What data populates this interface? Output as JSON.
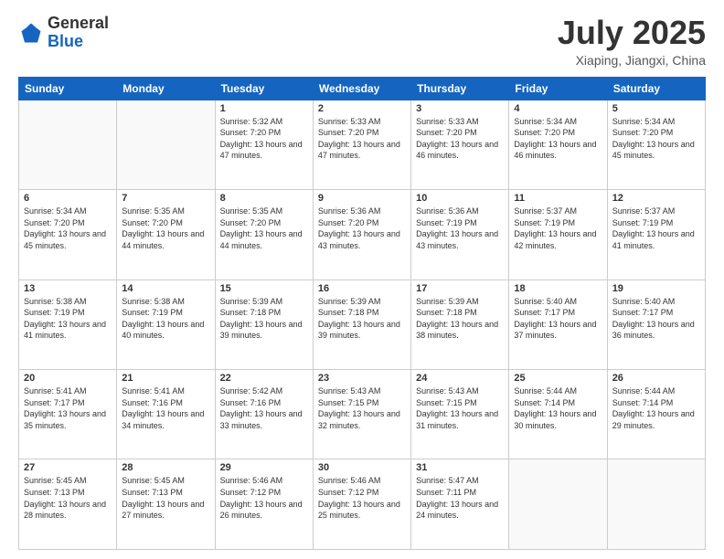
{
  "header": {
    "logo_general": "General",
    "logo_blue": "Blue",
    "month_title": "July 2025",
    "location": "Xiaping, Jiangxi, China"
  },
  "days_of_week": [
    "Sunday",
    "Monday",
    "Tuesday",
    "Wednesday",
    "Thursday",
    "Friday",
    "Saturday"
  ],
  "weeks": [
    [
      {
        "day": "",
        "sunrise": "",
        "sunset": "",
        "daylight": ""
      },
      {
        "day": "",
        "sunrise": "",
        "sunset": "",
        "daylight": ""
      },
      {
        "day": "1",
        "sunrise": "Sunrise: 5:32 AM",
        "sunset": "Sunset: 7:20 PM",
        "daylight": "Daylight: 13 hours and 47 minutes."
      },
      {
        "day": "2",
        "sunrise": "Sunrise: 5:33 AM",
        "sunset": "Sunset: 7:20 PM",
        "daylight": "Daylight: 13 hours and 47 minutes."
      },
      {
        "day": "3",
        "sunrise": "Sunrise: 5:33 AM",
        "sunset": "Sunset: 7:20 PM",
        "daylight": "Daylight: 13 hours and 46 minutes."
      },
      {
        "day": "4",
        "sunrise": "Sunrise: 5:34 AM",
        "sunset": "Sunset: 7:20 PM",
        "daylight": "Daylight: 13 hours and 46 minutes."
      },
      {
        "day": "5",
        "sunrise": "Sunrise: 5:34 AM",
        "sunset": "Sunset: 7:20 PM",
        "daylight": "Daylight: 13 hours and 45 minutes."
      }
    ],
    [
      {
        "day": "6",
        "sunrise": "Sunrise: 5:34 AM",
        "sunset": "Sunset: 7:20 PM",
        "daylight": "Daylight: 13 hours and 45 minutes."
      },
      {
        "day": "7",
        "sunrise": "Sunrise: 5:35 AM",
        "sunset": "Sunset: 7:20 PM",
        "daylight": "Daylight: 13 hours and 44 minutes."
      },
      {
        "day": "8",
        "sunrise": "Sunrise: 5:35 AM",
        "sunset": "Sunset: 7:20 PM",
        "daylight": "Daylight: 13 hours and 44 minutes."
      },
      {
        "day": "9",
        "sunrise": "Sunrise: 5:36 AM",
        "sunset": "Sunset: 7:20 PM",
        "daylight": "Daylight: 13 hours and 43 minutes."
      },
      {
        "day": "10",
        "sunrise": "Sunrise: 5:36 AM",
        "sunset": "Sunset: 7:19 PM",
        "daylight": "Daylight: 13 hours and 43 minutes."
      },
      {
        "day": "11",
        "sunrise": "Sunrise: 5:37 AM",
        "sunset": "Sunset: 7:19 PM",
        "daylight": "Daylight: 13 hours and 42 minutes."
      },
      {
        "day": "12",
        "sunrise": "Sunrise: 5:37 AM",
        "sunset": "Sunset: 7:19 PM",
        "daylight": "Daylight: 13 hours and 41 minutes."
      }
    ],
    [
      {
        "day": "13",
        "sunrise": "Sunrise: 5:38 AM",
        "sunset": "Sunset: 7:19 PM",
        "daylight": "Daylight: 13 hours and 41 minutes."
      },
      {
        "day": "14",
        "sunrise": "Sunrise: 5:38 AM",
        "sunset": "Sunset: 7:19 PM",
        "daylight": "Daylight: 13 hours and 40 minutes."
      },
      {
        "day": "15",
        "sunrise": "Sunrise: 5:39 AM",
        "sunset": "Sunset: 7:18 PM",
        "daylight": "Daylight: 13 hours and 39 minutes."
      },
      {
        "day": "16",
        "sunrise": "Sunrise: 5:39 AM",
        "sunset": "Sunset: 7:18 PM",
        "daylight": "Daylight: 13 hours and 39 minutes."
      },
      {
        "day": "17",
        "sunrise": "Sunrise: 5:39 AM",
        "sunset": "Sunset: 7:18 PM",
        "daylight": "Daylight: 13 hours and 38 minutes."
      },
      {
        "day": "18",
        "sunrise": "Sunrise: 5:40 AM",
        "sunset": "Sunset: 7:17 PM",
        "daylight": "Daylight: 13 hours and 37 minutes."
      },
      {
        "day": "19",
        "sunrise": "Sunrise: 5:40 AM",
        "sunset": "Sunset: 7:17 PM",
        "daylight": "Daylight: 13 hours and 36 minutes."
      }
    ],
    [
      {
        "day": "20",
        "sunrise": "Sunrise: 5:41 AM",
        "sunset": "Sunset: 7:17 PM",
        "daylight": "Daylight: 13 hours and 35 minutes."
      },
      {
        "day": "21",
        "sunrise": "Sunrise: 5:41 AM",
        "sunset": "Sunset: 7:16 PM",
        "daylight": "Daylight: 13 hours and 34 minutes."
      },
      {
        "day": "22",
        "sunrise": "Sunrise: 5:42 AM",
        "sunset": "Sunset: 7:16 PM",
        "daylight": "Daylight: 13 hours and 33 minutes."
      },
      {
        "day": "23",
        "sunrise": "Sunrise: 5:43 AM",
        "sunset": "Sunset: 7:15 PM",
        "daylight": "Daylight: 13 hours and 32 minutes."
      },
      {
        "day": "24",
        "sunrise": "Sunrise: 5:43 AM",
        "sunset": "Sunset: 7:15 PM",
        "daylight": "Daylight: 13 hours and 31 minutes."
      },
      {
        "day": "25",
        "sunrise": "Sunrise: 5:44 AM",
        "sunset": "Sunset: 7:14 PM",
        "daylight": "Daylight: 13 hours and 30 minutes."
      },
      {
        "day": "26",
        "sunrise": "Sunrise: 5:44 AM",
        "sunset": "Sunset: 7:14 PM",
        "daylight": "Daylight: 13 hours and 29 minutes."
      }
    ],
    [
      {
        "day": "27",
        "sunrise": "Sunrise: 5:45 AM",
        "sunset": "Sunset: 7:13 PM",
        "daylight": "Daylight: 13 hours and 28 minutes."
      },
      {
        "day": "28",
        "sunrise": "Sunrise: 5:45 AM",
        "sunset": "Sunset: 7:13 PM",
        "daylight": "Daylight: 13 hours and 27 minutes."
      },
      {
        "day": "29",
        "sunrise": "Sunrise: 5:46 AM",
        "sunset": "Sunset: 7:12 PM",
        "daylight": "Daylight: 13 hours and 26 minutes."
      },
      {
        "day": "30",
        "sunrise": "Sunrise: 5:46 AM",
        "sunset": "Sunset: 7:12 PM",
        "daylight": "Daylight: 13 hours and 25 minutes."
      },
      {
        "day": "31",
        "sunrise": "Sunrise: 5:47 AM",
        "sunset": "Sunset: 7:11 PM",
        "daylight": "Daylight: 13 hours and 24 minutes."
      },
      {
        "day": "",
        "sunrise": "",
        "sunset": "",
        "daylight": ""
      },
      {
        "day": "",
        "sunrise": "",
        "sunset": "",
        "daylight": ""
      }
    ]
  ]
}
